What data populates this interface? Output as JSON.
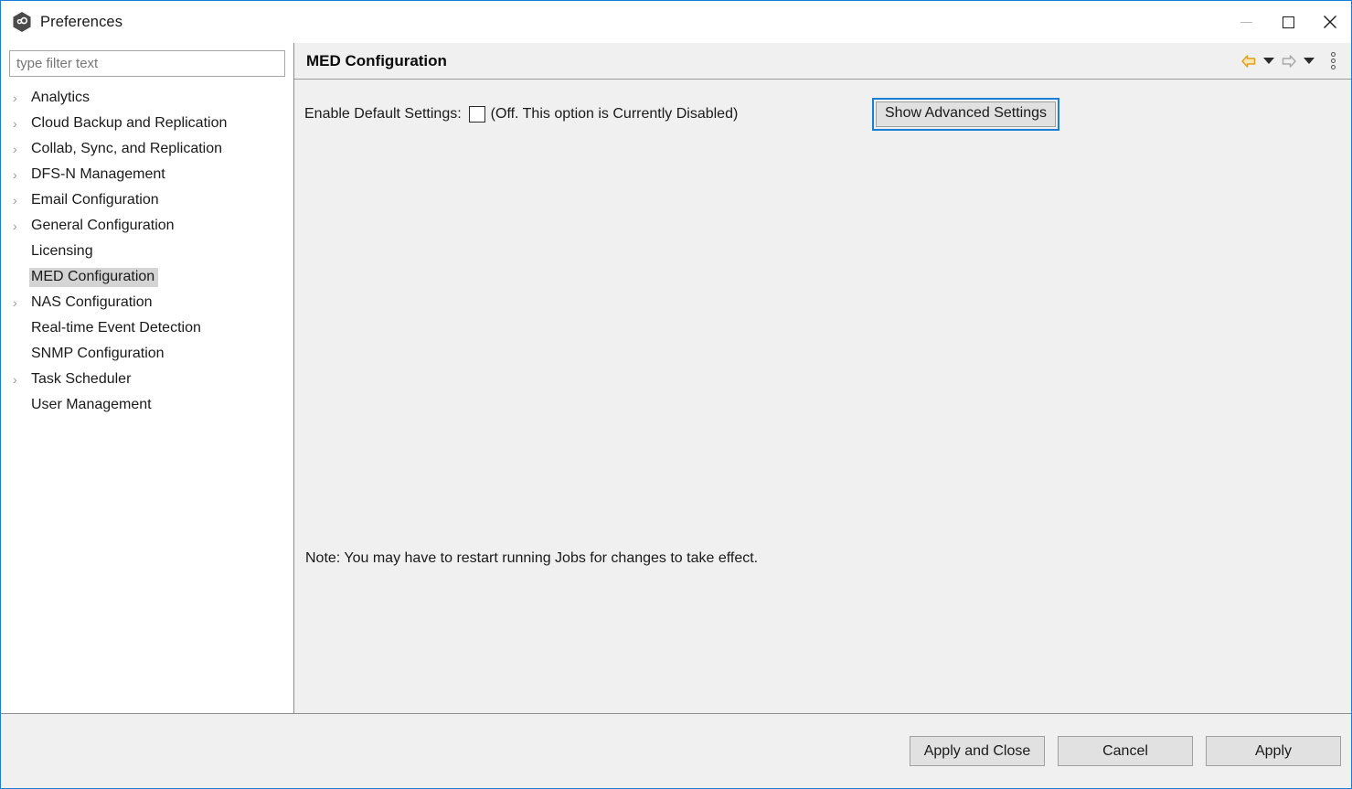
{
  "window": {
    "title": "Preferences",
    "app_icon": "hexagon-infinity-icon",
    "controls": {
      "minimize": "minimize-icon",
      "maximize": "maximize-icon",
      "close": "close-icon"
    }
  },
  "sidebar": {
    "filter": {
      "value": "",
      "placeholder": "type filter text"
    },
    "items": [
      {
        "label": "Analytics",
        "expandable": true,
        "selected": false
      },
      {
        "label": "Cloud Backup and Replication",
        "expandable": true,
        "selected": false
      },
      {
        "label": "Collab, Sync, and Replication",
        "expandable": true,
        "selected": false
      },
      {
        "label": "DFS-N Management",
        "expandable": true,
        "selected": false
      },
      {
        "label": "Email Configuration",
        "expandable": true,
        "selected": false
      },
      {
        "label": "General Configuration",
        "expandable": true,
        "selected": false
      },
      {
        "label": "Licensing",
        "expandable": false,
        "selected": false
      },
      {
        "label": "MED Configuration",
        "expandable": false,
        "selected": true
      },
      {
        "label": "NAS Configuration",
        "expandable": true,
        "selected": false
      },
      {
        "label": "Real-time Event Detection",
        "expandable": false,
        "selected": false
      },
      {
        "label": "SNMP Configuration",
        "expandable": false,
        "selected": false
      },
      {
        "label": "Task Scheduler",
        "expandable": true,
        "selected": false
      },
      {
        "label": "User Management",
        "expandable": false,
        "selected": false
      }
    ],
    "expand_glyph": "›"
  },
  "content": {
    "title": "MED Configuration",
    "tools": [
      {
        "name": "back-arrow-icon",
        "label": "Back"
      },
      {
        "name": "back-history-dropdown-icon",
        "label": "Back history"
      },
      {
        "name": "forward-arrow-icon",
        "label": "Forward"
      },
      {
        "name": "forward-history-dropdown-icon",
        "label": "Forward history"
      },
      {
        "name": "view-menu-icon",
        "label": "View menu"
      }
    ],
    "option": {
      "label": "Enable Default Settings:",
      "checked": false,
      "state_note": "(Off. This option is Currently Disabled)"
    },
    "advanced_button": "Show Advanced Settings",
    "note": "Note: You may have to restart running Jobs for changes to take effect."
  },
  "footer": {
    "apply_and_close": "Apply and Close",
    "cancel": "Cancel",
    "apply": "Apply"
  },
  "colors": {
    "window_border": "#1a7fd4",
    "panel_bg": "#f0f0f0",
    "selection": "#d4d4d4",
    "focus_border": "#1a7fd4",
    "back_arrow": "#d9a321"
  }
}
